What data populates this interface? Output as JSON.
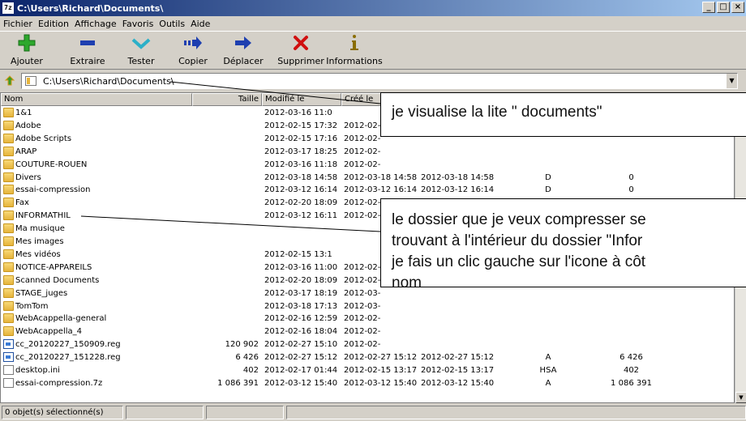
{
  "window": {
    "app_icon": "7z",
    "title": "C:\\Users\\Richard\\Documents\\",
    "buttons": [
      "_",
      "□",
      "×"
    ]
  },
  "menu": [
    "Fichier",
    "Edition",
    "Affichage",
    "Favoris",
    "Outils",
    "Aide"
  ],
  "toolbar": [
    {
      "label": "Ajouter",
      "icon": "add-icon",
      "color": "#2da82d"
    },
    {
      "label": "Extraire",
      "icon": "extract-icon",
      "color": "#1e3fb0"
    },
    {
      "label": "Tester",
      "icon": "test-icon",
      "color": "#2bb0c8"
    },
    {
      "label": "Copier",
      "icon": "copy-icon",
      "color": "#1e3fb0"
    },
    {
      "label": "Déplacer",
      "icon": "move-icon",
      "color": "#1e3fb0"
    },
    {
      "label": "Supprimer",
      "icon": "delete-icon",
      "color": "#d01010"
    },
    {
      "label": "Informations",
      "icon": "info-icon",
      "color": "#8a6d00"
    }
  ],
  "address": {
    "value": "C:\\Users\\Richard\\Documents\\"
  },
  "columns": {
    "name": "Nom",
    "size": "Taille",
    "modified": "Modifié le",
    "created": "Créé le"
  },
  "files": [
    {
      "name": "1&1",
      "type": "folder",
      "size": "",
      "modified": "2012-03-16 11:0",
      "created": "",
      "accessed": "",
      "attr": "",
      "packed": ""
    },
    {
      "name": "Adobe",
      "type": "folder",
      "size": "",
      "modified": "2012-02-15 17:32",
      "created": "2012-02-",
      "accessed": "",
      "attr": "",
      "packed": ""
    },
    {
      "name": "Adobe Scripts",
      "type": "folder",
      "size": "",
      "modified": "2012-02-15 17:16",
      "created": "2012-02-",
      "accessed": "",
      "attr": "",
      "packed": ""
    },
    {
      "name": "ARAP",
      "type": "folder",
      "size": "",
      "modified": "2012-03-17 18:25",
      "created": "2012-02-",
      "accessed": "",
      "attr": "",
      "packed": ""
    },
    {
      "name": "COUTURE-ROUEN",
      "type": "folder",
      "size": "",
      "modified": "2012-03-16 11:18",
      "created": "2012-02-",
      "accessed": "",
      "attr": "",
      "packed": ""
    },
    {
      "name": "Divers",
      "type": "folder",
      "size": "",
      "modified": "2012-03-18 14:58",
      "created": "2012-03-18 14:58",
      "accessed": "2012-03-18 14:58",
      "attr": "D",
      "packed": "0"
    },
    {
      "name": "essai-compression",
      "type": "folder",
      "size": "",
      "modified": "2012-03-12 16:14",
      "created": "2012-03-12 16:14",
      "accessed": "2012-03-12 16:14",
      "attr": "D",
      "packed": "0"
    },
    {
      "name": "Fax",
      "type": "folder",
      "size": "",
      "modified": "2012-02-20 18:09",
      "created": "2012-02-",
      "accessed": "",
      "attr": "",
      "packed": ""
    },
    {
      "name": "INFORMATHIL",
      "type": "folder",
      "size": "",
      "modified": "2012-03-12 16:11",
      "created": "2012-02-",
      "accessed": "",
      "attr": "",
      "packed": ""
    },
    {
      "name": "Ma musique",
      "type": "folder",
      "size": "",
      "modified": "",
      "created": "",
      "accessed": "",
      "attr": "",
      "packed": ""
    },
    {
      "name": "Mes images",
      "type": "folder",
      "size": "",
      "modified": "",
      "created": "",
      "accessed": "",
      "attr": "",
      "packed": ""
    },
    {
      "name": "Mes vidéos",
      "type": "folder",
      "size": "",
      "modified": "2012-02-15 13:1",
      "created": "",
      "accessed": "",
      "attr": "",
      "packed": ""
    },
    {
      "name": "NOTICE-APPAREILS",
      "type": "folder",
      "size": "",
      "modified": "2012-03-16 11:00",
      "created": "2012-02-",
      "accessed": "",
      "attr": "",
      "packed": ""
    },
    {
      "name": "Scanned Documents",
      "type": "folder",
      "size": "",
      "modified": "2012-02-20 18:09",
      "created": "2012-02-",
      "accessed": "",
      "attr": "",
      "packed": ""
    },
    {
      "name": "STAGE_juges",
      "type": "folder",
      "size": "",
      "modified": "2012-03-17 18:19",
      "created": "2012-03-",
      "accessed": "",
      "attr": "",
      "packed": ""
    },
    {
      "name": "TomTom",
      "type": "folder",
      "size": "",
      "modified": "2012-03-18 17:13",
      "created": "2012-03-",
      "accessed": "",
      "attr": "",
      "packed": ""
    },
    {
      "name": "WebAcappella-general",
      "type": "folder",
      "size": "",
      "modified": "2012-02-16 12:59",
      "created": "2012-02-",
      "accessed": "",
      "attr": "",
      "packed": ""
    },
    {
      "name": "WebAcappella_4",
      "type": "folder",
      "size": "",
      "modified": "2012-02-16 18:04",
      "created": "2012-02-",
      "accessed": "",
      "attr": "",
      "packed": ""
    },
    {
      "name": "cc_20120227_150909.reg",
      "type": "reg",
      "size": "120 902",
      "modified": "2012-02-27 15:10",
      "created": "2012-02-",
      "accessed": "",
      "attr": "",
      "packed": ""
    },
    {
      "name": "cc_20120227_151228.reg",
      "type": "reg",
      "size": "6 426",
      "modified": "2012-02-27 15:12",
      "created": "2012-02-27 15:12",
      "accessed": "2012-02-27 15:12",
      "attr": "A",
      "packed": "6 426"
    },
    {
      "name": "desktop.ini",
      "type": "file",
      "size": "402",
      "modified": "2012-02-17 01:44",
      "created": "2012-02-15 13:17",
      "accessed": "2012-02-15 13:17",
      "attr": "HSA",
      "packed": "402"
    },
    {
      "name": "essai-compression.7z",
      "type": "file",
      "size": "1 086 391",
      "modified": "2012-03-12 15:40",
      "created": "2012-03-12 15:40",
      "accessed": "2012-03-12 15:40",
      "attr": "A",
      "packed": "1 086 391"
    }
  ],
  "status": {
    "selected": "0 objet(s) sélectionné(s)"
  },
  "callouts": [
    {
      "lines": [
        "je visualise la lite \" documents\""
      ]
    },
    {
      "lines": [
        "le dossier que je veux compresser se",
        "trouvant à l'intérieur du dossier \"Infor",
        "je fais un clic gauche sur l'icone à côt",
        "nom"
      ]
    }
  ]
}
